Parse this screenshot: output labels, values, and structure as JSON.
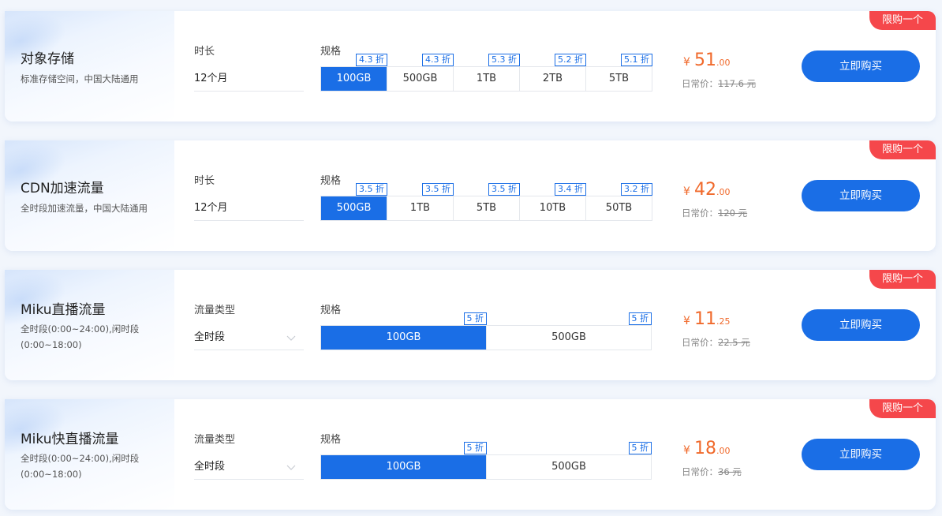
{
  "products": [
    {
      "title": "对象存储",
      "desc": "标准存储空间，中国大陆通用",
      "field_label": "时长",
      "field_value": "12个月",
      "spec_label": "规格",
      "specs": [
        {
          "label": "100GB",
          "discount": "4.3 折"
        },
        {
          "label": "500GB",
          "discount": "4.3 折"
        },
        {
          "label": "1TB",
          "discount": "5.3 折"
        },
        {
          "label": "2TB",
          "discount": "5.2 折"
        },
        {
          "label": "5TB",
          "discount": "5.1 折"
        }
      ],
      "price_currency": "¥",
      "price_int": "51",
      "price_dec": ".00",
      "orig_label": "日常价：",
      "orig_value": "117.6 元",
      "buy_label": "立即购买",
      "badge": "限购一个"
    },
    {
      "title": "CDN加速流量",
      "desc": "全时段加速流量，中国大陆通用",
      "field_label": "时长",
      "field_value": "12个月",
      "spec_label": "规格",
      "specs": [
        {
          "label": "500GB",
          "discount": "3.5 折"
        },
        {
          "label": "1TB",
          "discount": "3.5 折"
        },
        {
          "label": "5TB",
          "discount": "3.5 折"
        },
        {
          "label": "10TB",
          "discount": "3.4 折"
        },
        {
          "label": "50TB",
          "discount": "3.2 折"
        }
      ],
      "price_currency": "¥",
      "price_int": "42",
      "price_dec": ".00",
      "orig_label": "日常价：",
      "orig_value": "120 元",
      "buy_label": "立即购买",
      "badge": "限购一个"
    },
    {
      "title": "Miku直播流量",
      "desc": "全时段(0:00~24:00),闲时段(0:00~18:00)",
      "field_label": "流量类型",
      "field_value": "全时段",
      "spec_label": "规格",
      "specs": [
        {
          "label": "100GB",
          "discount": "5 折"
        },
        {
          "label": "500GB",
          "discount": "5 折"
        }
      ],
      "price_currency": "¥",
      "price_int": "11",
      "price_dec": ".25",
      "orig_label": "日常价：",
      "orig_value": "22.5 元",
      "buy_label": "立即购买",
      "badge": "限购一个"
    },
    {
      "title": "Miku快直播流量",
      "desc": "全时段(0:00~24:00),闲时段(0:00~18:00)",
      "field_label": "流量类型",
      "field_value": "全时段",
      "spec_label": "规格",
      "specs": [
        {
          "label": "100GB",
          "discount": "5 折"
        },
        {
          "label": "500GB",
          "discount": "5 折"
        }
      ],
      "price_currency": "¥",
      "price_int": "18",
      "price_dec": ".00",
      "orig_label": "日常价：",
      "orig_value": "36 元",
      "buy_label": "立即购买",
      "badge": "限购一个"
    }
  ],
  "colors": {
    "accent": "#1a6ee6",
    "price": "#f0692b",
    "badge": "#f5474b"
  },
  "icons": {
    "select_chevron": "chevron-down-icon"
  }
}
